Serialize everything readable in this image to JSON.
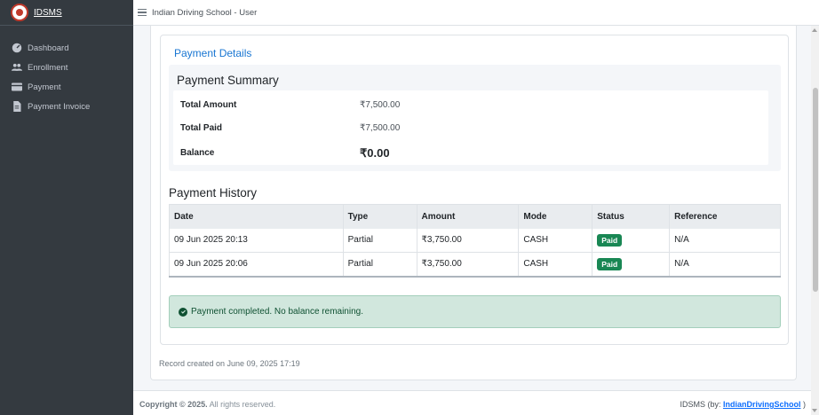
{
  "brand": {
    "name": "IDSMS"
  },
  "sidebar": {
    "items": [
      {
        "label": "Dashboard",
        "icon": "dashboard-icon"
      },
      {
        "label": "Enrollment",
        "icon": "users-icon"
      },
      {
        "label": "Payment",
        "icon": "credit-card-icon"
      },
      {
        "label": "Payment Invoice",
        "icon": "invoice-icon"
      }
    ]
  },
  "topbar": {
    "title": "Indian Driving School - User",
    "right_text": ""
  },
  "payment_details": {
    "link_label": "Payment Details"
  },
  "summary": {
    "title": "Payment Summary",
    "rows": [
      {
        "label": "Total Amount",
        "value": "₹7,500.00"
      },
      {
        "label": "Total Paid",
        "value": "₹7,500.00"
      },
      {
        "label": "Balance",
        "value": "₹0.00"
      }
    ]
  },
  "history": {
    "title": "Payment History",
    "columns": [
      "Date",
      "Type",
      "Amount",
      "Mode",
      "Status",
      "Reference"
    ],
    "rows": [
      {
        "date": "09 Jun 2025 20:13",
        "type": "Partial",
        "amount": "₹3,750.00",
        "mode": "CASH",
        "status": "Paid",
        "reference": "N/A"
      },
      {
        "date": "09 Jun 2025 20:06",
        "type": "Partial",
        "amount": "₹3,750.00",
        "mode": "CASH",
        "status": "Paid",
        "reference": "N/A"
      }
    ]
  },
  "alert": {
    "text": "Payment completed. No balance remaining."
  },
  "record": {
    "text": "Record created on June 09, 2025 17:19"
  },
  "footer": {
    "copyright_bold": "Copyright © 2025.",
    "copyright_rest": "All rights reserved.",
    "right_prefix": "IDSMS (by:",
    "right_link": "IndianDrivingSchool",
    "right_suffix": ")"
  },
  "colors": {
    "sidebar_bg": "#343a40",
    "link": "#1976d2",
    "success": "#198754",
    "alert_bg": "#d1e7dd"
  }
}
